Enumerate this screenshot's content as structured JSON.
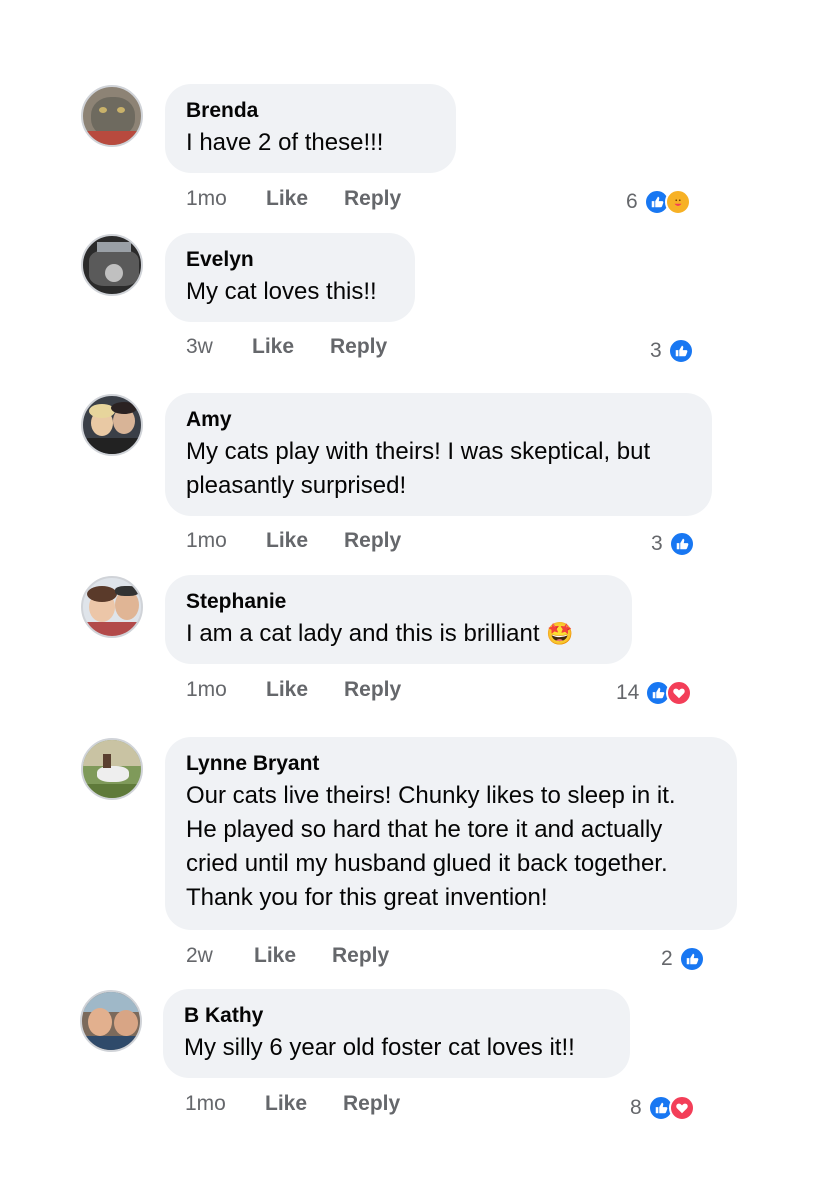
{
  "colors": {
    "like_blue": "#1877f2",
    "love_red": "#f33e58",
    "bubble_bg": "#f0f2f5",
    "meta_gray": "#65676b"
  },
  "comments": [
    {
      "author": "Brenda",
      "text": "I have 2 of these!!!",
      "time": "1mo",
      "like_label": "Like",
      "reply_label": "Reply",
      "reaction_count": "6",
      "reactions": [
        "like-icon",
        "care-icon"
      ]
    },
    {
      "author": "Evelyn",
      "text": "My cat loves this!!",
      "time": "3w",
      "like_label": "Like",
      "reply_label": "Reply",
      "reaction_count": "3",
      "reactions": [
        "like-icon"
      ]
    },
    {
      "author": "Amy",
      "text_lines": [
        "My cats play with theirs!  I was skeptical, but",
        "pleasantly surprised!"
      ],
      "time": "1mo",
      "like_label": "Like",
      "reply_label": "Reply",
      "reaction_count": "3",
      "reactions": [
        "like-icon"
      ]
    },
    {
      "author": "Stephanie",
      "text": "I am a cat lady and this is brilliant",
      "emoji": "🤩",
      "time": "1mo",
      "like_label": "Like",
      "reply_label": "Reply",
      "reaction_count": "14",
      "reactions": [
        "like-icon",
        "love-icon"
      ]
    },
    {
      "author": "Lynne Bryant",
      "text_lines": [
        "Our cats live theirs! Chunky likes to sleep in it.",
        "He played so hard that he tore it and actually",
        "cried until my husband glued it back together.",
        "Thank you for this great invention!"
      ],
      "time": "2w",
      "like_label": "Like",
      "reply_label": "Reply",
      "reaction_count": "2",
      "reactions": [
        "like-icon"
      ]
    },
    {
      "author": "B Kathy",
      "text": "My silly 6 year old foster cat loves it!!",
      "time": "1mo",
      "like_label": "Like",
      "reply_label": "Reply",
      "reaction_count": "8",
      "reactions": [
        "like-icon",
        "love-icon"
      ]
    }
  ]
}
